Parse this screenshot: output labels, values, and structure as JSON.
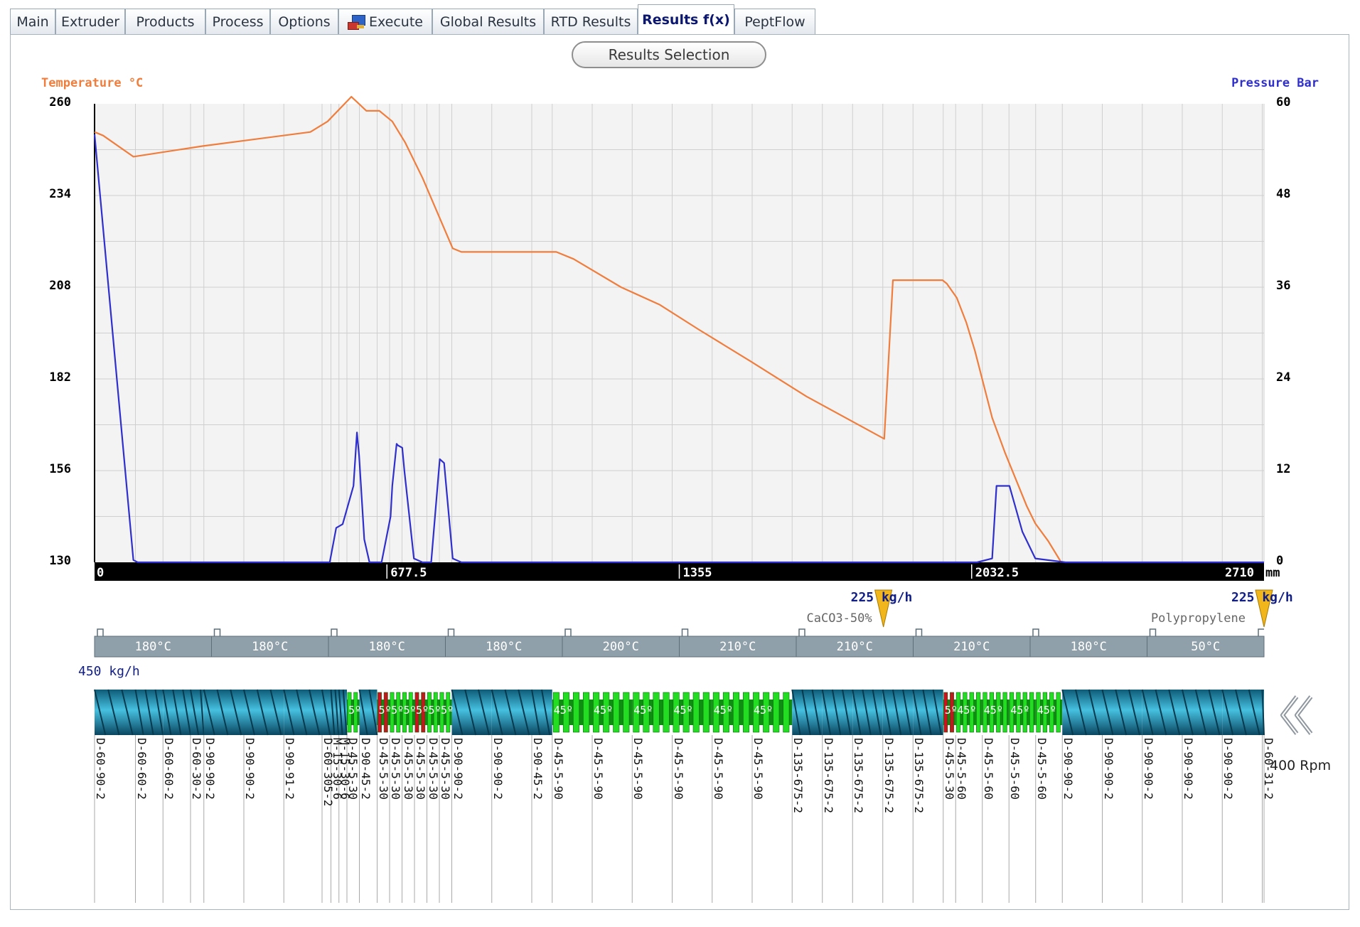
{
  "tabs": [
    {
      "label": "Main",
      "active": false
    },
    {
      "label": "Extruder",
      "active": false
    },
    {
      "label": "Products",
      "active": false
    },
    {
      "label": "Process",
      "active": false
    },
    {
      "label": "Options",
      "active": false
    },
    {
      "label": "Execute",
      "active": false,
      "icon": "computer-icon"
    },
    {
      "label": "Global Results",
      "active": false
    },
    {
      "label": "RTD Results",
      "active": false
    },
    {
      "label": "Results f(x)",
      "active": true
    },
    {
      "label": "PeptFlow",
      "active": false
    }
  ],
  "results_selection_label": "Results Selection",
  "colors": {
    "temperature": "#f07d3c",
    "pressure": "#2f2fcd",
    "axis_bar": "#000000",
    "zone": "#90a0aa",
    "screw": "#1f8fb0",
    "kneading": "#22dd22",
    "reverse": "#c8141e"
  },
  "chart_data": {
    "type": "line",
    "y_left_label": "Temperature °C",
    "y_right_label": "Pressure Bar",
    "y_left_ticks": [
      "260",
      "234",
      "208",
      "182",
      "156",
      "130"
    ],
    "y_right_ticks": [
      "60",
      "48",
      "36",
      "24",
      "12",
      "0"
    ],
    "y_left_range": [
      130,
      260
    ],
    "y_right_range": [
      0,
      60
    ],
    "x_range": [
      0,
      2710
    ],
    "x_ticks": [
      "0",
      "677.5",
      "1355",
      "2032.5",
      "2710"
    ],
    "x_unit": "mm",
    "grid": true,
    "series": [
      {
        "name": "Temperature °C",
        "axis": "left",
        "x": [
          0,
          20,
          90,
          250,
          500,
          540,
          595,
          630,
          660,
          690,
          720,
          760,
          830,
          850,
          1070,
          1110,
          1220,
          1310,
          1400,
          1520,
          1650,
          1830,
          1850,
          1965,
          1975,
          1998,
          2020,
          2040,
          2080,
          2110,
          2140,
          2160,
          2180,
          2210,
          2240
        ],
        "y": [
          252,
          251,
          245,
          248,
          252,
          255,
          262,
          258,
          258,
          255,
          249,
          239,
          219,
          218,
          218,
          216,
          208,
          203,
          196,
          187,
          177,
          165,
          210,
          210,
          209,
          205,
          198,
          190,
          171,
          161,
          152,
          146,
          141,
          136,
          130
        ]
      },
      {
        "name": "Pressure Bar",
        "axis": "right",
        "x": [
          0,
          90,
          100,
          545,
          560,
          575,
          600,
          608,
          613,
          625,
          637,
          650,
          660,
          665,
          686,
          690,
          700,
          703,
          713,
          718,
          740,
          760,
          780,
          800,
          810,
          830,
          850,
          2045,
          2080,
          2090,
          2120,
          2150,
          2180,
          2250,
          2710
        ],
        "y": [
          56,
          0.3,
          0,
          0,
          4.5,
          5,
          10,
          17,
          14,
          3,
          0,
          0,
          0,
          0,
          6,
          10,
          15.5,
          15.3,
          15,
          12,
          0.5,
          0,
          0,
          13.5,
          13,
          0.5,
          0,
          0,
          0.5,
          10,
          10,
          4,
          0.5,
          0,
          0
        ]
      }
    ]
  },
  "feeds": [
    {
      "rate": "225 kg/h",
      "material": "CaCO3-50%",
      "position_mm": 1828
    },
    {
      "rate": "225 kg/h",
      "material": "Polypropylene",
      "position_mm": 2710
    }
  ],
  "zones": [
    "180°C",
    "180°C",
    "180°C",
    "180°C",
    "200°C",
    "210°C",
    "210°C",
    "210°C",
    "180°C",
    "50°C"
  ],
  "total_feed": "450 kg/h",
  "rpm": "400 Rpm",
  "screw_elements": [
    {
      "label": "D-60-90-2",
      "type": "conveying",
      "length_mm": 92
    },
    {
      "label": "D-60-60-2",
      "type": "conveying",
      "length_mm": 62
    },
    {
      "label": "D-60-60-2",
      "type": "conveying",
      "length_mm": 62
    },
    {
      "label": "D-60-30-2",
      "type": "conveying",
      "length_mm": 30
    },
    {
      "label": "D-90-90-2",
      "type": "conveying",
      "length_mm": 90
    },
    {
      "label": "D-90-90-2",
      "type": "conveying",
      "length_mm": 90
    },
    {
      "label": "D-90-91-2",
      "type": "conveying",
      "length_mm": 86
    },
    {
      "label": "D-60-305-2",
      "type": "conveying",
      "length_mm": 20
    },
    {
      "label": "M-15-30-6",
      "type": "mixing",
      "length_mm": 18
    },
    {
      "label": "M-15-30-6",
      "type": "mixing",
      "length_mm": 18
    },
    {
      "label": "D-45-5-30",
      "type": "kneading",
      "angle": "5º",
      "length_mm": 28
    },
    {
      "label": "D-90-45-2",
      "type": "conveying",
      "length_mm": 40
    },
    {
      "label": "D-45-5-30",
      "type": "reverse",
      "angle": "5º",
      "length_mm": 28
    },
    {
      "label": "D-45-5-30",
      "type": "kneading",
      "angle": "5º",
      "length_mm": 28
    },
    {
      "label": "D-45-5-30",
      "type": "kneading",
      "angle": "5º",
      "length_mm": 28
    },
    {
      "label": "D-45-5-30",
      "type": "reverse",
      "angle": "5º",
      "length_mm": 28
    },
    {
      "label": "D-45-5-30",
      "type": "kneading",
      "angle": "5º",
      "length_mm": 28
    },
    {
      "label": "D-45-5-30",
      "type": "kneading",
      "angle": "5º",
      "length_mm": 28
    },
    {
      "label": "D-90-90-2",
      "type": "conveying",
      "length_mm": 90
    },
    {
      "label": "D-90-90-2",
      "type": "conveying",
      "length_mm": 90
    },
    {
      "label": "D-90-45-2",
      "type": "conveying",
      "length_mm": 46
    },
    {
      "label": "D-45-5-90",
      "type": "kneading",
      "angle": "45º",
      "length_mm": 90
    },
    {
      "label": "D-45-5-90",
      "type": "kneading",
      "angle": "45º",
      "length_mm": 90
    },
    {
      "label": "D-45-5-90",
      "type": "kneading",
      "angle": "45º",
      "length_mm": 90
    },
    {
      "label": "D-45-5-90",
      "type": "kneading",
      "angle": "45º",
      "length_mm": 90
    },
    {
      "label": "D-45-5-90",
      "type": "kneading",
      "angle": "45º",
      "length_mm": 90
    },
    {
      "label": "D-45-5-90",
      "type": "kneading",
      "angle": "45º",
      "length_mm": 90
    },
    {
      "label": "D-135-675-2",
      "type": "conveying",
      "length_mm": 68
    },
    {
      "label": "D-135-675-2",
      "type": "conveying",
      "length_mm": 68
    },
    {
      "label": "D-135-675-2",
      "type": "conveying",
      "length_mm": 68
    },
    {
      "label": "D-135-675-2",
      "type": "conveying",
      "length_mm": 68
    },
    {
      "label": "D-135-675-2",
      "type": "conveying",
      "length_mm": 68
    },
    {
      "label": "D-45-5-30",
      "type": "reverse",
      "angle": "5º",
      "length_mm": 28
    },
    {
      "label": "D-45-5-60",
      "type": "kneading",
      "angle": "45º",
      "length_mm": 60
    },
    {
      "label": "D-45-5-60",
      "type": "kneading",
      "angle": "45º",
      "length_mm": 60
    },
    {
      "label": "D-45-5-60",
      "type": "kneading",
      "angle": "45º",
      "length_mm": 60
    },
    {
      "label": "D-45-5-60",
      "type": "kneading",
      "angle": "45º",
      "length_mm": 60
    },
    {
      "label": "D-90-90-2",
      "type": "conveying",
      "length_mm": 90
    },
    {
      "label": "D-90-90-2",
      "type": "conveying",
      "length_mm": 90
    },
    {
      "label": "D-90-90-2",
      "type": "conveying",
      "length_mm": 90
    },
    {
      "label": "D-90-90-2",
      "type": "conveying",
      "length_mm": 90
    },
    {
      "label": "D-90-90-2",
      "type": "conveying",
      "length_mm": 90
    },
    {
      "label": "D-60-31-2",
      "type": "conveying",
      "length_mm": 4
    }
  ],
  "rewind_icon": "double-chevron-left-icon"
}
